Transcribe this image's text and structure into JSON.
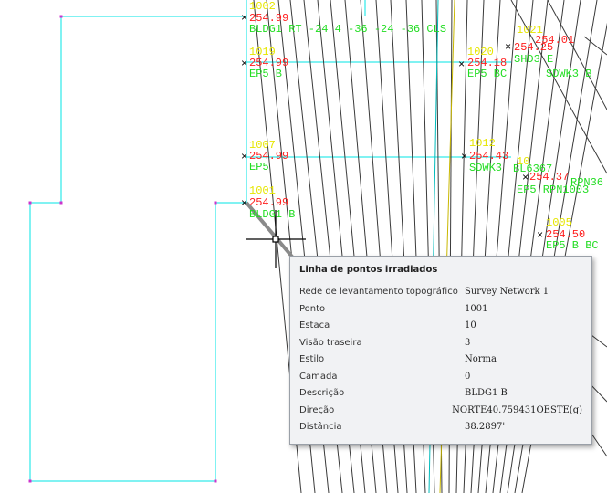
{
  "points": [
    {
      "id": "p1002",
      "number": "1002",
      "elevation": "254.99",
      "desc": "BLDG1 RT -24 4 -36 -24 -36 CLS"
    },
    {
      "id": "p1019",
      "number": "1019",
      "elevation": "254.99",
      "desc": "EP5 B"
    },
    {
      "id": "p1007",
      "number": "1007",
      "elevation": "254.99",
      "desc": "EP5"
    },
    {
      "id": "p1001",
      "number": "1001",
      "elevation": "254.99",
      "desc": "BLDG1 B"
    },
    {
      "id": "p1020",
      "number": "1020",
      "elevation": "254.18",
      "desc": "EP5 BC"
    },
    {
      "id": "p1021",
      "number": "1021",
      "elevation": "254.25",
      "desc": "SHD3 E"
    },
    {
      "id": "p1021e",
      "number": "",
      "elevation": "254.01",
      "desc": ""
    },
    {
      "id": "p1012",
      "number": "1012",
      "elevation": "254.43",
      "desc": "SDWK3"
    },
    {
      "id": "p1005",
      "number": "1005",
      "elevation": "254.50",
      "desc": "EP5 B BC"
    },
    {
      "id": "pcluster",
      "number": "10",
      "elevation": "254.37",
      "desc": "EP5 RPN1003"
    }
  ],
  "extra_labels": {
    "sdwk3b": "SDWK3 B",
    "rpn": "RPN36",
    "cluster_mix": "BL6367"
  },
  "colors": {
    "boundary": "#00e5e5",
    "radial": "#3a3a3a",
    "number": "#e6e600",
    "elevation": "#ff2020",
    "description": "#22dd22",
    "marker": "#000000"
  },
  "tooltip": {
    "title": "Linha de pontos irradiados",
    "rows": [
      {
        "label": "Rede de levantamento topográfico",
        "value": "Survey Network 1"
      },
      {
        "label": "Ponto",
        "value": "1001"
      },
      {
        "label": "Estaca",
        "value": "10"
      },
      {
        "label": "Visão traseira",
        "value": "3"
      },
      {
        "label": "Estilo",
        "value": "Norma"
      },
      {
        "label": "Camada",
        "value": "0"
      },
      {
        "label": "Descrição",
        "value": "BLDG1 B"
      },
      {
        "label": "Direção",
        "value": "NORTE40.759431OESTE(g)"
      },
      {
        "label": "Distância",
        "value": "38.2897'"
      }
    ]
  }
}
